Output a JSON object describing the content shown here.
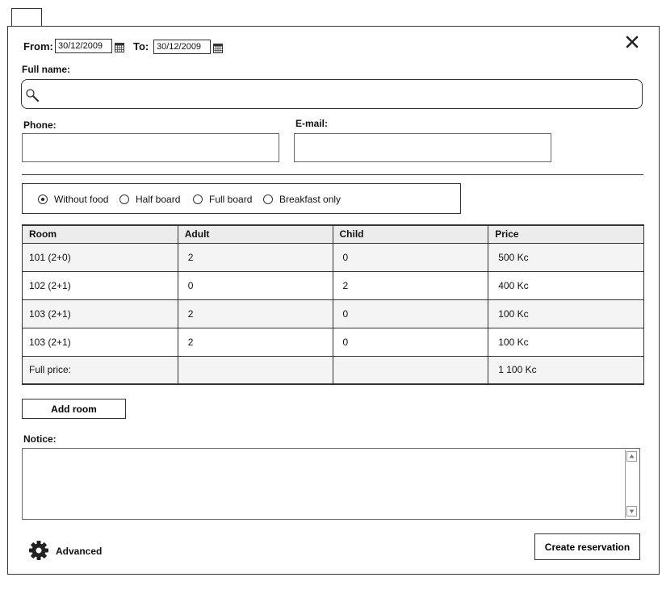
{
  "dates": {
    "from_label": "From:",
    "from_value": "30/12/2009",
    "to_label": "To:",
    "to_value": "30/12/2009"
  },
  "fullname": {
    "label": "Full name:",
    "value": ""
  },
  "phone": {
    "label": "Phone:",
    "value": ""
  },
  "email": {
    "label": "E-mail:",
    "value": ""
  },
  "board": {
    "options": [
      "Without food",
      "Half board",
      "Full board",
      "Breakfast only"
    ],
    "selected": "Without food"
  },
  "table": {
    "headers": [
      "Room",
      "Adult",
      "Child",
      "Price"
    ],
    "rows": [
      [
        "101 (2+0)",
        "2",
        "0",
        "500 Kc"
      ],
      [
        "102 (2+1)",
        "0",
        "2",
        "400 Kc"
      ],
      [
        "103 (2+1)",
        "2",
        "0",
        "100 Kc"
      ],
      [
        "103 (2+1)",
        "2",
        "0",
        "100 Kc"
      ]
    ],
    "total_label": "Full price:",
    "total_value": "1 100 Kc"
  },
  "buttons": {
    "add_room": "Add room",
    "create_reservation": "Create reservation"
  },
  "notice": {
    "label": "Notice:",
    "value": ""
  },
  "advanced": {
    "label": "Advanced"
  }
}
